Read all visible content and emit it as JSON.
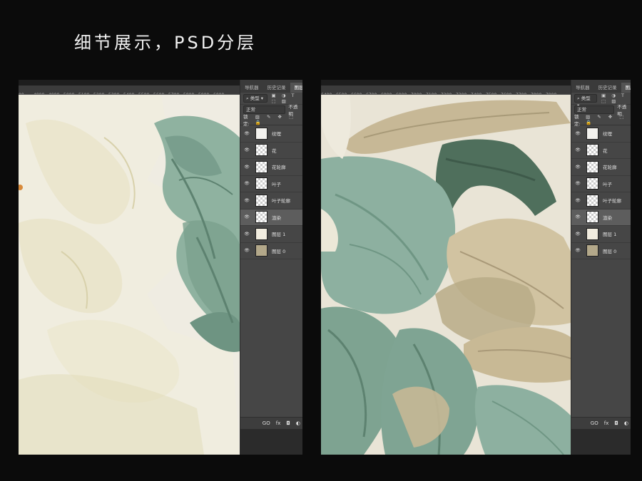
{
  "headline": "细节展示，PSD分层",
  "left_window": {
    "ruler_ticks": [
      "00",
      "4800",
      "4900",
      "5000",
      "5100",
      "5200",
      "5300",
      "5400",
      "5500",
      "5600",
      "5700",
      "5800",
      "5900",
      "6000",
      "6100",
      "6200"
    ]
  },
  "right_window": {
    "ruler_ticks": [
      "6400",
      "6500",
      "6600",
      "6700",
      "6800",
      "6900",
      "7000",
      "7100",
      "7200",
      "7300",
      "7400",
      "7500",
      "7600",
      "7700",
      "7800",
      "7900",
      "8000",
      "8100"
    ]
  },
  "layers_panel": {
    "tabs": [
      "导航器",
      "历史记录",
      "图层"
    ],
    "active_tab": "图层",
    "filter_label": "类型",
    "filter_icons": "▣ ◑ T ⬚ ▨",
    "blend_mode": "正常",
    "opacity_label": "不透明",
    "lock_label": "锁定:",
    "lock_icons": "▨ ✎ ✥ ⬚ 🔒",
    "layers": [
      {
        "name": "纹理",
        "thumb": "#f3f2ee",
        "selected": false
      },
      {
        "name": "花",
        "thumb": "transparent",
        "selected": false
      },
      {
        "name": "花轮廓",
        "thumb": "transparent",
        "selected": false
      },
      {
        "name": "叶子",
        "thumb": "transparent",
        "selected": false
      },
      {
        "name": "叶子轮廓",
        "thumb": "transparent",
        "selected": false
      },
      {
        "name": "渲染",
        "thumb": "transparent",
        "selected": true
      },
      {
        "name": "图层 1",
        "thumb": "#f1ecdf",
        "selected": false
      },
      {
        "name": "图层 0",
        "thumb": "#b3a88a",
        "selected": false
      }
    ],
    "bottom_icons": [
      "GO",
      "fx",
      "◘",
      "◐"
    ]
  },
  "colors": {
    "background": "#0b0b0b",
    "paper": "#efece2",
    "leaf_green": "#7fa493",
    "leaf_dark": "#4f6f5c",
    "leaf_tan": "#c6b797",
    "panel_bg": "#464646"
  }
}
